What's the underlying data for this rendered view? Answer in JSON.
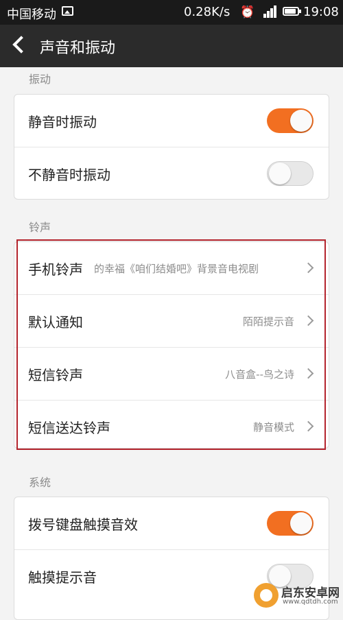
{
  "status_bar": {
    "carrier": "中国移动",
    "speed": "0.28K/s",
    "time": "19:08"
  },
  "header": {
    "title": "声音和振动"
  },
  "sections": {
    "vibration": {
      "label": "振动",
      "items": [
        {
          "label": "静音时振动",
          "toggle": "on"
        },
        {
          "label": "不静音时振动",
          "toggle": "off"
        }
      ]
    },
    "ringtone": {
      "label": "铃声",
      "items": [
        {
          "label": "手机铃声",
          "value": "的幸福《咱们结婚吧》背景音电视剧"
        },
        {
          "label": "默认通知",
          "value": "陌陌提示音"
        },
        {
          "label": "短信铃声",
          "value": "八音盒--鸟之诗"
        },
        {
          "label": "短信送达铃声",
          "value": "静音模式"
        }
      ]
    },
    "system": {
      "label": "系统",
      "items": [
        {
          "label": "拨号键盘触摸音效",
          "toggle": "on"
        },
        {
          "label": "触摸提示音",
          "toggle": "off"
        }
      ]
    }
  },
  "watermark": {
    "title": "启东安卓网",
    "url": "www.qdtdh.com"
  },
  "colors": {
    "accent": "#f26f21",
    "highlight_border": "#b3232c",
    "titlebar": "#2b2b2b"
  }
}
